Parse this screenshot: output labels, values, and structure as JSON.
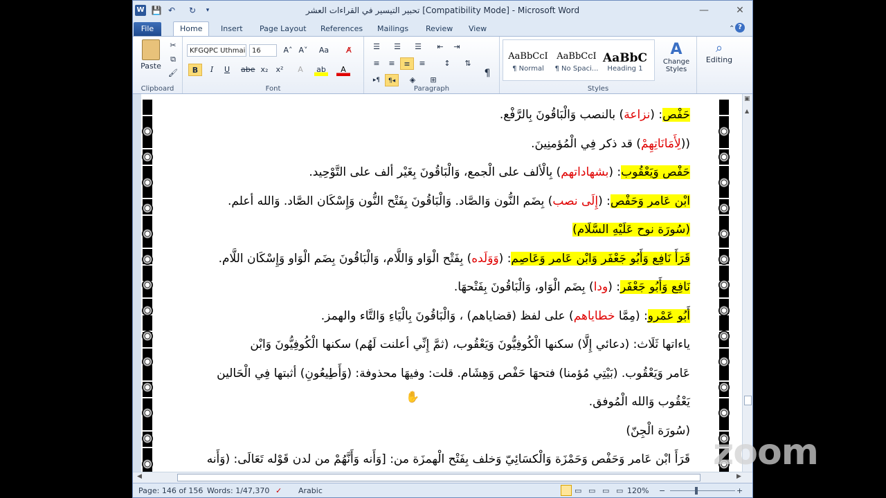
{
  "window": {
    "title": "تحبير التيسير في القراءات العشر [Compatibility Mode] - Microsoft Word",
    "controls": {
      "minimize": "—",
      "maximize": "☐",
      "close": "✕"
    }
  },
  "quick_access": {
    "word": "W",
    "save": "💾",
    "undo": "↶",
    "redo": "↻"
  },
  "tabs": [
    "File",
    "Home",
    "Insert",
    "Page Layout",
    "References",
    "Mailings",
    "Review",
    "View"
  ],
  "ribbon": {
    "clipboard": {
      "label": "Clipboard",
      "paste": "Paste"
    },
    "font": {
      "label": "Font",
      "name": "KFGQPC Uthmai",
      "size": "16",
      "bold": "B",
      "italic": "I",
      "underline": "U",
      "strike": "abe",
      "sub": "x₂",
      "sup": "x²",
      "grow": "A˄",
      "shrink": "A˅",
      "case": "Aa"
    },
    "paragraph": {
      "label": "Paragraph",
      "pilcrow": "¶"
    },
    "styles": {
      "label": "Styles",
      "items": [
        {
          "sample": "AaBbCcI",
          "name": "¶ Normal"
        },
        {
          "sample": "AaBbCcI",
          "name": "¶ No Spaci..."
        },
        {
          "sample": "AaBbC",
          "name": "Heading 1"
        }
      ],
      "change": "Change Styles"
    },
    "editing": {
      "label": "Editing"
    }
  },
  "document": {
    "lines": [
      [
        {
          "t": "حَفْص",
          "y": true
        },
        {
          "t": ": ("
        },
        {
          "t": "نزاعة",
          "r": true
        },
        {
          "t": ") بالنصب وَالْبَاقُونَ بِالرَّفْع."
        }
      ],
      [
        {
          "t": "(("
        },
        {
          "t": "لِأَمَانَاتِهِمْ",
          "r": true
        },
        {
          "t": ") قد ذكر فِي الْمُؤمنِينَ."
        }
      ],
      [
        {
          "t": "حَفْص وَيَعْقُوب",
          "y": true
        },
        {
          "t": ": ("
        },
        {
          "t": "بشهاداتهم",
          "r": true
        },
        {
          "t": ") بِالْألف على الْجمع، وَالْبَاقُونَ بِغَيْر ألف على التَّوْحِيد."
        }
      ],
      [
        {
          "t": "ابْن عَامر وَحَفْص",
          "y": true
        },
        {
          "t": ": ("
        },
        {
          "t": "إِلَى نصب",
          "r": true
        },
        {
          "t": ") بِضَم النُّون وَالصَّاد. وَالْبَاقُونَ بِفَتْح النُّون وَإِسْكَان الصَّاد. وَالله أعلم."
        }
      ],
      [
        {
          "t": "(سُورَة نوح عَلَيْهِ السَّلَام)",
          "y": true
        }
      ],
      [
        {
          "t": "قَرَأَ نَافِع وَأَبُو جَعْفَر وَابْن عَامر وَعَاصِم",
          "y": true
        },
        {
          "t": ": ("
        },
        {
          "t": "وَوَلَده",
          "r": true
        },
        {
          "t": ") بِفَتْح الْوَاو وَاللَّام، وَالْبَاقُونَ بِضَم الْوَاو وَإِسْكَان اللَّام."
        }
      ],
      [
        {
          "t": "نَافِع وَأَبُو جَعْفَر",
          "y": true
        },
        {
          "t": ": ("
        },
        {
          "t": "ودا",
          "r": true
        },
        {
          "t": ") بِضَم الْوَاو، وَالْبَاقُونَ بِفَتْحهَا."
        }
      ],
      [
        {
          "t": "أَبُو عَمْرو",
          "y": true
        },
        {
          "t": ": (مِمَّا "
        },
        {
          "t": "خطاياهم",
          "r": true
        },
        {
          "t": ") على لفظ (قضاياهم) ، وَالْبَاقُونَ بِالْيَاءِ وَالتَّاء والهمز."
        }
      ],
      [
        {
          "t": "ياءاتها ثَلَاث: (دعائي إِلَّا) سكنها الْكُوفِيُّونَ وَيَعْقُوب، (ثمَّ إِنِّي أعلنت لَهُم) سكنها الْكُوفِيُّونَ وَابْن"
        }
      ],
      [
        {
          "t": "عَامر وَيَعْقُوب. (بَيْتِي مُؤمنا) فتحهَا حَفْص وَهِشَام. قلت: وفيهَا محذوفة: (وَأَطِيعُونِ) أثبتها فِي الْحَالين"
        }
      ],
      [
        {
          "t": "يَعْقُوب وَالله الْمُوفق."
        }
      ],
      [
        {
          "t": "(سُورَة الْجِنّ)"
        }
      ],
      [
        {
          "t": "قَرَأَ ابْن عَامر وَحَفْص وَحَمْزَة وَالْكسَائِيّ وَخلف بِفَتْح الْهمزَة من: [وَأَنه وَأَنَّهُمْ من لدن قَوْله تَعَالَى: (وَأَنه"
        }
      ]
    ]
  },
  "status": {
    "page": "Page: 146 of 156",
    "words": "Words: 1/47,370",
    "language": "Arabic",
    "zoom": "120%"
  },
  "overlay": {
    "logo": "zoom"
  }
}
